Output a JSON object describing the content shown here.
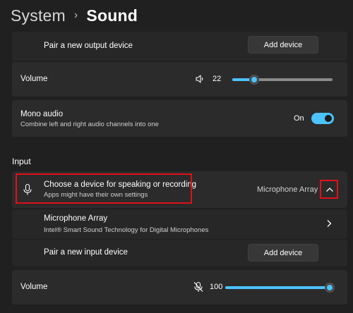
{
  "breadcrumb": {
    "root": "System",
    "separator": "›",
    "current": "Sound"
  },
  "output": {
    "pair_label": "Pair a new output device",
    "add_device_label": "Add device",
    "volume_label": "Volume",
    "volume_value": "22",
    "volume_level_percent": 22,
    "speaker_icon": "speaker-icon",
    "mono": {
      "title": "Mono audio",
      "subtitle": "Combine left and right audio channels into one",
      "toggle_state": "On"
    }
  },
  "input": {
    "section_title": "Input",
    "choose": {
      "title": "Choose a device for speaking or recording",
      "subtitle": "Apps might have their own settings",
      "selected_device": "Microphone Array",
      "icon": "microphone-icon",
      "expand_icon": "chevron-up-icon"
    },
    "device": {
      "name": "Microphone Array",
      "description": "Intel® Smart Sound Technology for Digital Microphones",
      "icon": "chevron-right-icon"
    },
    "pair_label": "Pair a new input device",
    "add_device_label": "Add device",
    "volume_label": "Volume",
    "volume_value": "100",
    "volume_level_percent": 100,
    "mic_icon": "microphone-muted-icon"
  },
  "colors": {
    "accent": "#4cc2ff",
    "highlight_border": "#e0101a",
    "background": "#202020",
    "card": "#2b2b2b"
  }
}
